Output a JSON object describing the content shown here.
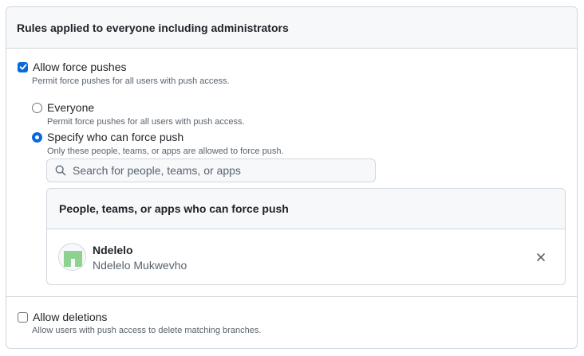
{
  "header": {
    "title": "Rules applied to everyone including administrators"
  },
  "force_push": {
    "label": "Allow force pushes",
    "checked": true,
    "description": "Permit force pushes for all users with push access.",
    "options": [
      {
        "label": "Everyone",
        "description": "Permit force pushes for all users with push access.",
        "selected": false
      },
      {
        "label": "Specify who can force push",
        "description": "Only these people, teams, or apps are allowed to force push.",
        "selected": true
      }
    ],
    "search": {
      "placeholder": "Search for people, teams, or apps",
      "value": ""
    },
    "allowed_list": {
      "title": "People, teams, or apps who can force push",
      "items": [
        {
          "login": "Ndelelo",
          "name": "Ndelelo Mukwevho",
          "avatar_color": "#8fd18f"
        }
      ]
    }
  },
  "deletions": {
    "label": "Allow deletions",
    "checked": false,
    "description": "Allow users with push access to delete matching branches."
  },
  "colors": {
    "accent": "#0969da",
    "border": "#d0d7de",
    "muted": "#59636e"
  },
  "icons": {
    "search": "search-icon",
    "remove": "x-icon",
    "check": "check-icon"
  }
}
